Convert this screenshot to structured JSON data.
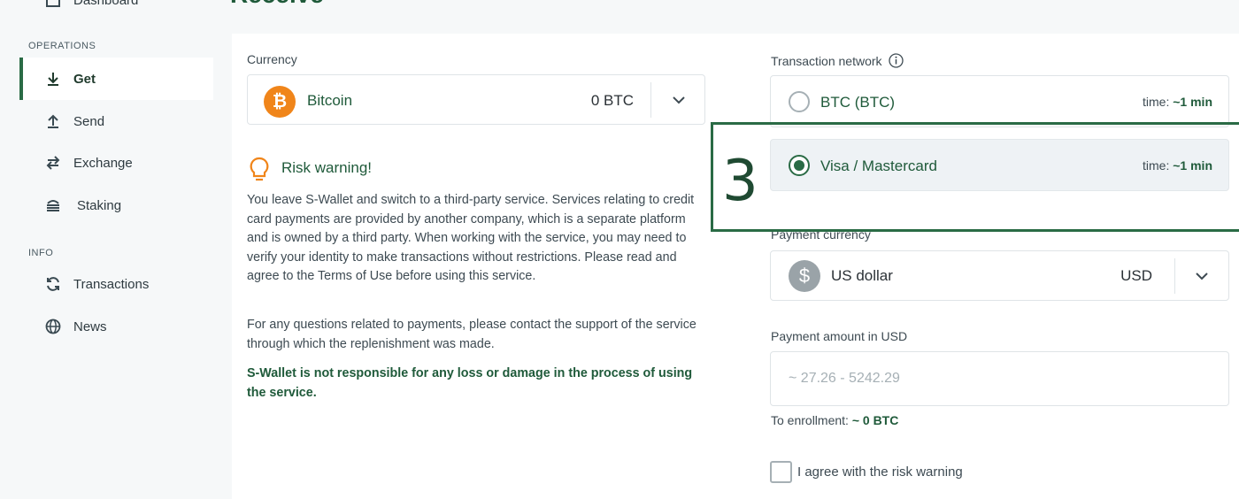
{
  "header": {
    "page_title": "Receive"
  },
  "sidebar": {
    "top_item": "Dashboard",
    "operations_label": "OPERATIONS",
    "operations": [
      {
        "label": "Get",
        "icon": "download-icon",
        "active": true
      },
      {
        "label": "Send",
        "icon": "upload-icon"
      },
      {
        "label": "Exchange",
        "icon": "exchange-icon"
      },
      {
        "label": "Staking",
        "icon": "staking-icon"
      }
    ],
    "info_label": "INFO",
    "info": [
      {
        "label": "Transactions",
        "icon": "refresh-icon"
      },
      {
        "label": "News",
        "icon": "globe-icon"
      }
    ]
  },
  "currency": {
    "label": "Currency",
    "name": "Bitcoin",
    "amount": "0 BTC",
    "icon": "bitcoin-icon",
    "icon_color": "#f0851a"
  },
  "warning": {
    "title": "Risk warning!",
    "paragraph1": "You leave S-Wallet and switch to a third-party service. Services relating to credit card payments are provided by another company, which is a separate platform and is owned by a third party. When working with the service, you may need to verify your identity to make transactions without restrictions. Please read and agree to the Terms of Use before using this service.",
    "paragraph2": "For any questions related to payments, please contact the support of the service through which the replenishment was made.",
    "paragraph3": "S-Wallet is not responsible for any loss or damage in the process of using the service."
  },
  "network": {
    "label": "Transaction network",
    "options": [
      {
        "name": "BTC (BTC)",
        "time_label": "time:",
        "time_value": "~1 min",
        "selected": false
      },
      {
        "name": "Visa / Mastercard",
        "time_label": "time:",
        "time_value": "~1 min",
        "selected": true
      }
    ]
  },
  "annotation": {
    "step": "3"
  },
  "payment_currency": {
    "label": "Payment currency",
    "name": "US dollar",
    "code": "USD",
    "icon": "dollar-icon"
  },
  "payment_amount": {
    "label": "Payment amount in USD",
    "placeholder": "~ 27.26 - 5242.29"
  },
  "enrollment": {
    "label": "To enrollment:",
    "value": "~ 0 BTC"
  },
  "agreement": {
    "label": "I agree with the risk warning"
  },
  "colors": {
    "accent": "#2a6b45",
    "text_green": "#1f5a3a"
  }
}
